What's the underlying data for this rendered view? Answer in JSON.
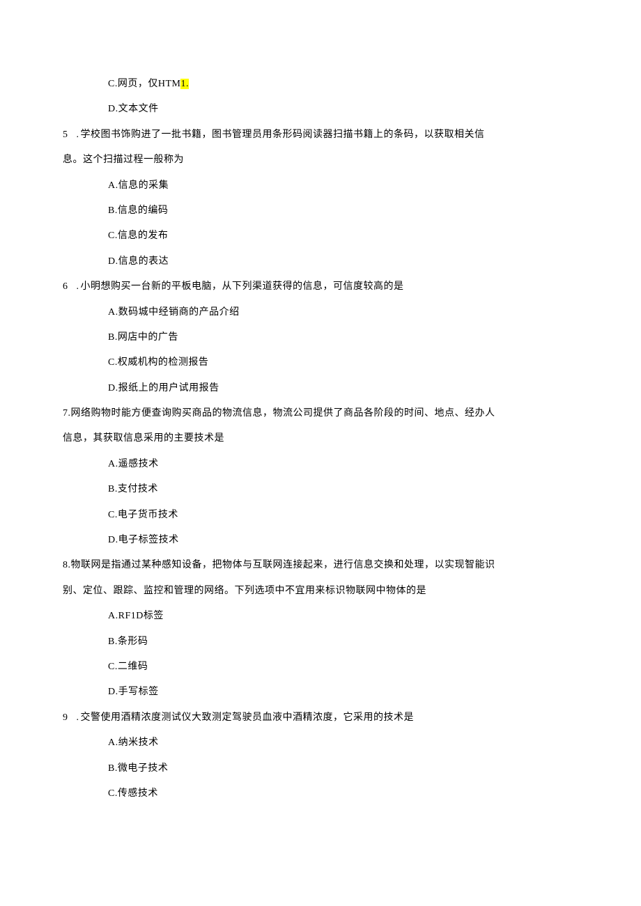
{
  "q4": {
    "optC_pre": "C.网页，仅HTM",
    "optC_hl": "1.",
    "optD": "D.文本文件"
  },
  "q5": {
    "num": "5",
    "dot": ".",
    "stem_line1": "学校图书饰购进了一批书籍，图书管理员用条形码阅读器扫描书籍上的条码，以获取相关信",
    "stem_line2": "息。这个扫描过程一般称为",
    "optA": "A.信息的采集",
    "optB": "B.信息的编码",
    "optC": "C.信息的发布",
    "optD": "D.信息的表达"
  },
  "q6": {
    "num": "6",
    "dot": ".",
    "stem": "小明想购买一台新的平板电脑，从下列渠道获得的信息，可信度较高的是",
    "optA": "A.数码城中经销商的产品介绍",
    "optB": "B.网店中的广告",
    "optC": "C.权威机构的检测报告",
    "optD": "D.报纸上的用户试用报告"
  },
  "q7": {
    "stem_line1": "7.网络购物时能方便查询购买商品的物流信息，物流公司提供了商品各阶段的时间、地点、经办人",
    "stem_line2": "信息，其获取信息采用的主要技术是",
    "optA": "A.遥感技术",
    "optB": "B.支付技术",
    "optC": "C.电子货币技术",
    "optD": "D.电子标签技术"
  },
  "q8": {
    "stem_line1": "8.物联网是指通过某种感知设备，把物体与互联网连接起来，进行信息交换和处理，以实现智能识",
    "stem_line2": "别、定位、跟踪、监控和管理的网络。下列选项中不宜用来标识物联网中物体的是",
    "optA": "A.RF1D标签",
    "optB": "B.条形码",
    "optC": "C.二维码",
    "optD": "D.手写标签"
  },
  "q9": {
    "num": "9",
    "dot": ".",
    "stem": "交警使用酒精浓度测试仪大致测定驾驶员血液中酒精浓度，它采用的技术是",
    "optA": "A.纳米技术",
    "optB": "B.微电子技术",
    "optC": "C.传感技术"
  }
}
